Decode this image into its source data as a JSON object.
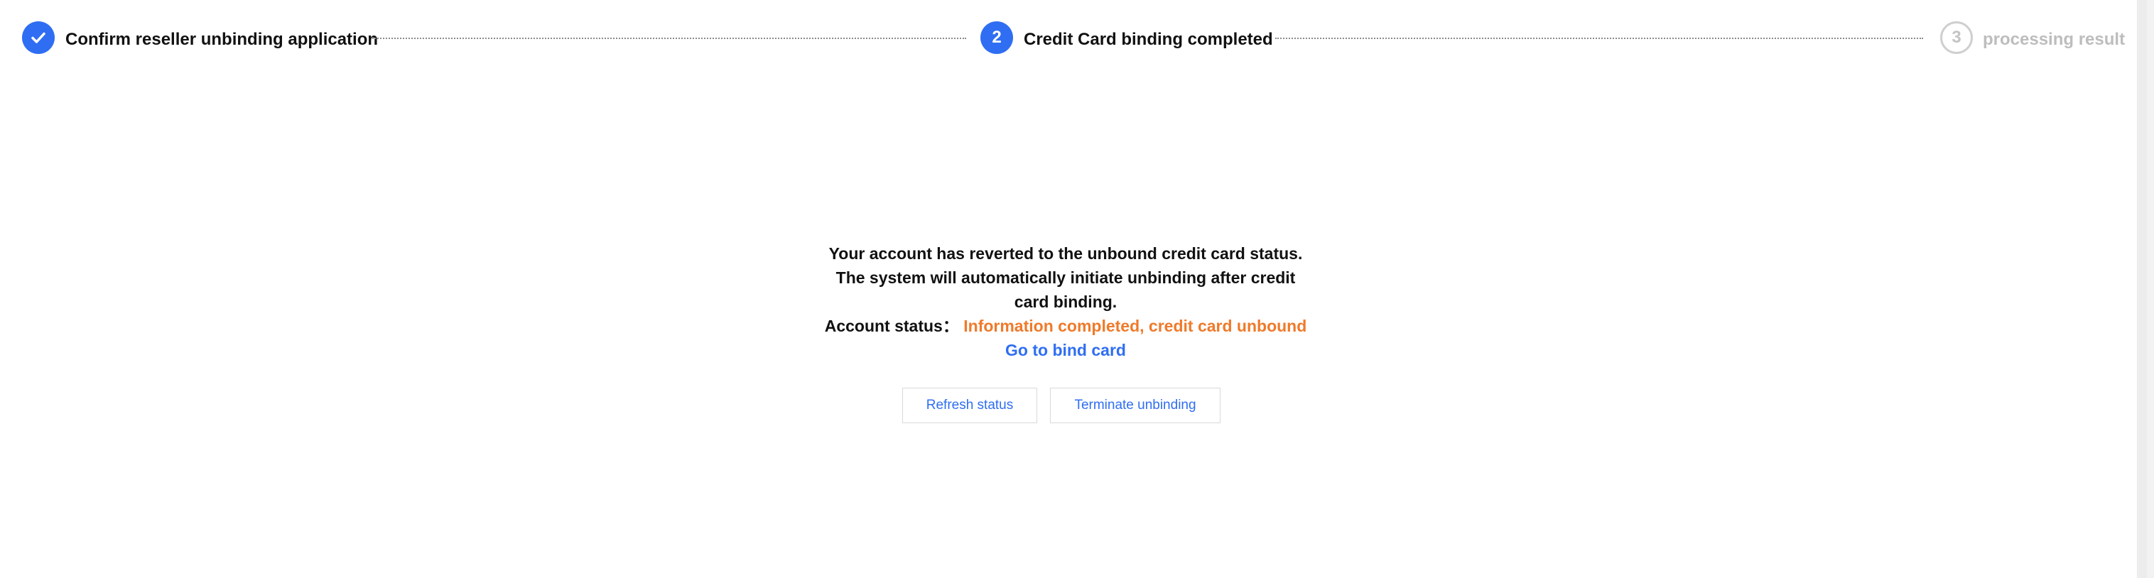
{
  "stepper": {
    "steps": [
      {
        "label": "Confirm reseller unbinding application",
        "state": "done"
      },
      {
        "number": "2",
        "label": "Credit Card binding completed",
        "state": "active"
      },
      {
        "number": "3",
        "label": "processing result",
        "state": "pending"
      }
    ]
  },
  "main": {
    "message": "Your account has reverted to the unbound credit card status. The system will automatically initiate unbinding after credit card binding.",
    "status_label": "Account status：",
    "status_value": "Information completed, credit card unbound",
    "bind_link": "Go to bind card",
    "buttons": {
      "refresh": "Refresh status",
      "terminate": "Terminate unbinding"
    }
  },
  "colors": {
    "accent": "#2f6ef2",
    "warning": "#ef7a2a",
    "pending": "#bdbdbd"
  }
}
